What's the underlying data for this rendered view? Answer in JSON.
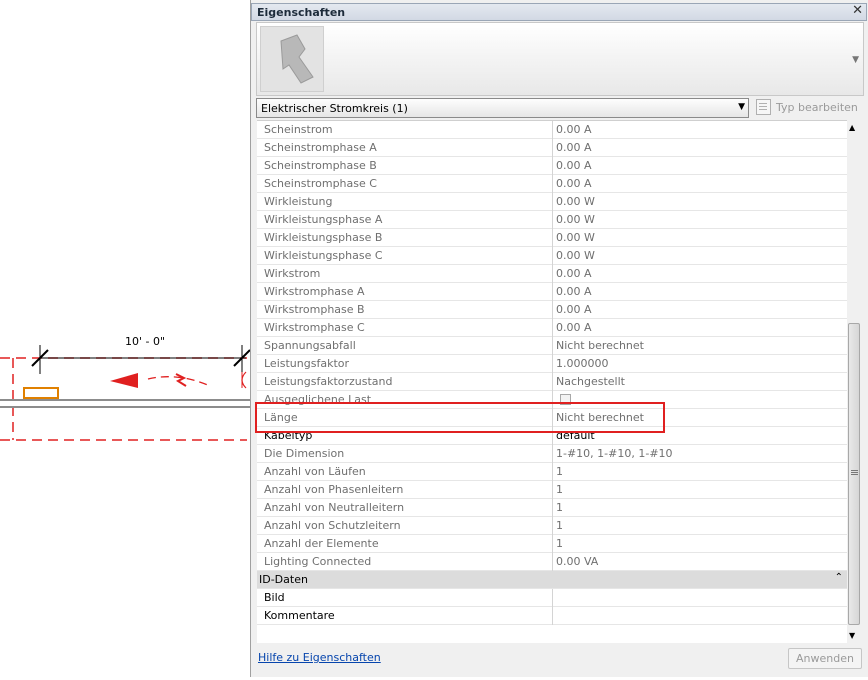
{
  "canvas": {
    "dimension_label": "10' - 0\"",
    "accent_color": "#e02020",
    "element_color": "#e08000"
  },
  "palette": {
    "title": "Eigenschaften",
    "close_icon": "close-icon",
    "type_selector": {
      "value": "Elektrischer Stromkreis (1)"
    },
    "edit_type_label": "Typ bearbeiten",
    "rows": [
      {
        "name": "Scheinstrom",
        "value": "0.00 A"
      },
      {
        "name": "Scheinstromphase A",
        "value": "0.00 A"
      },
      {
        "name": "Scheinstromphase B",
        "value": "0.00 A"
      },
      {
        "name": "Scheinstromphase C",
        "value": "0.00 A"
      },
      {
        "name": "Wirkleistung",
        "value": "0.00 W"
      },
      {
        "name": "Wirkleistungsphase A",
        "value": "0.00 W"
      },
      {
        "name": "Wirkleistungsphase B",
        "value": "0.00 W"
      },
      {
        "name": "Wirkleistungsphase C",
        "value": "0.00 W"
      },
      {
        "name": "Wirkstrom",
        "value": "0.00 A"
      },
      {
        "name": "Wirkstromphase A",
        "value": "0.00 A"
      },
      {
        "name": "Wirkstromphase B",
        "value": "0.00 A"
      },
      {
        "name": "Wirkstromphase C",
        "value": "0.00 A"
      },
      {
        "name": "Spannungsabfall",
        "value": "Nicht berechnet"
      },
      {
        "name": "Leistungsfaktor",
        "value": "1.000000"
      },
      {
        "name": "Leistungsfaktorzustand",
        "value": "Nachgestellt"
      },
      {
        "name": "Ausgeglichene Last",
        "value": ""
      },
      {
        "name": "Länge",
        "value": "Nicht berechnet"
      },
      {
        "name": "Kabeltyp",
        "value": "default"
      },
      {
        "name": "Die Dimension",
        "value": "1-#10, 1-#10, 1-#10"
      },
      {
        "name": "Anzahl von Läufen",
        "value": "1"
      },
      {
        "name": "Anzahl von Phasenleitern",
        "value": "1"
      },
      {
        "name": "Anzahl von Neutralleitern",
        "value": "1"
      },
      {
        "name": "Anzahl von Schutzleitern",
        "value": "1"
      },
      {
        "name": "Anzahl der Elemente",
        "value": "1"
      },
      {
        "name": "Lighting Connected",
        "value": "0.00 VA"
      }
    ],
    "group": {
      "label": "ID-Daten"
    },
    "id_rows": [
      {
        "name": "Bild",
        "value": ""
      },
      {
        "name": "Kommentare",
        "value": ""
      }
    ],
    "help_link": "Hilfe zu Eigenschaften",
    "apply_button": "Anwenden"
  }
}
